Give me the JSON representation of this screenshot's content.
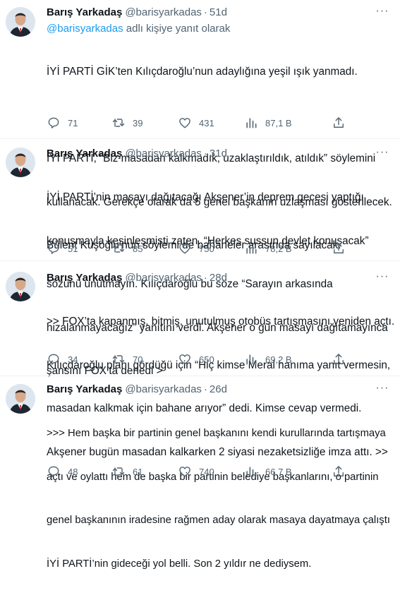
{
  "tweets": [
    {
      "name": "Barış Yarkadaş",
      "handle": "@barisyarkadas",
      "time": "51d",
      "reply_to": {
        "mention": "@barisyarkadas",
        "rest": " adlı kişiye yanıt olarak"
      },
      "lines": [
        "İYİ PARTİ GİK’ten Kılıçdaroğlu’nun adaylığına yeşil ışık yanmadı.",
        "",
        "İYİ PARTİ, “Biz masadan kalkmadık, uzaklaştırıldık, atıldık” söylemini",
        "kullanacak. Gerekçe olarak da 5 genel başkanın uzlaşması gösterilecek.",
        "Bülent Kuşoğlu’nun söylemi de bahaneler arasında sayılacak."
      ],
      "replies": "71",
      "retweets": "39",
      "likes": "431",
      "views": "87,1 B"
    },
    {
      "name": "Barış Yarkadaş",
      "handle": "@barisyarkadas",
      "time": "31d",
      "lines": [
        "İYİ PARTİ’nin masayı dağıtacağı Akşener’in deprem gecesi yaptığı",
        "konuşmayla kesinleşmişti zaten. “Herkes sussun devlet konuşacak”",
        "sözünü unutmayın. Kılıçdaroğlu bu söze “Sarayın arkasında",
        "hizalanmayacağız” yanıtını verdi. Akşener o gün masayı dağıtamayınca",
        "şansını FOX’ta denedi >"
      ],
      "replies": "51",
      "retweets": "85",
      "likes": "750",
      "views": "78,2 B"
    },
    {
      "name": "Barış Yarkadaş",
      "handle": "@barisyarkadas",
      "time": "28d",
      "lines": [
        ">> FOX’ta kapanmış, bitmiş, unutulmuş otobüs tartışmasını yeniden açtı.",
        "Kılıçdaroğlu planı gördüğü için “Hiç kimse Meral hanıma yanıt vermesin,",
        "masadan kalkmak için bahane arıyor” dedi. Kimse cevap vermedi.",
        "Akşener bugün masadan kalkarken 2 siyasi nezaketsizliğe imza attı. >>"
      ],
      "replies": "34",
      "retweets": "70",
      "likes": "650",
      "views": "69,2 B"
    },
    {
      "name": "Barış Yarkadaş",
      "handle": "@barisyarkadas",
      "time": "26d",
      "lines": [
        ">>> Hem başka bir partinin genel başkanını kendi kurullarında tartışmaya",
        "açtı ve oylattı hem de başka bir partinin belediye başkanlarını, o partinin",
        "genel başkanının iradesine rağmen aday olarak masaya dayatmaya çalıştı",
        "İYİ PARTİ’nin gideceği yol belli. Son 2 yıldır ne dediysem."
      ],
      "replies": "48",
      "retweets": "61",
      "likes": "740",
      "views": "66,7 B"
    }
  ],
  "icons": {
    "avatar": "profile-photo",
    "more": "more-dots-icon",
    "reply": "reply-icon",
    "retweet": "retweet-icon",
    "like": "heart-icon",
    "views": "views-chart-icon",
    "share": "share-icon"
  },
  "colors": {
    "text": "#0f1419",
    "muted": "#536471",
    "link": "#1d9bf0",
    "border": "#eff3f4"
  }
}
